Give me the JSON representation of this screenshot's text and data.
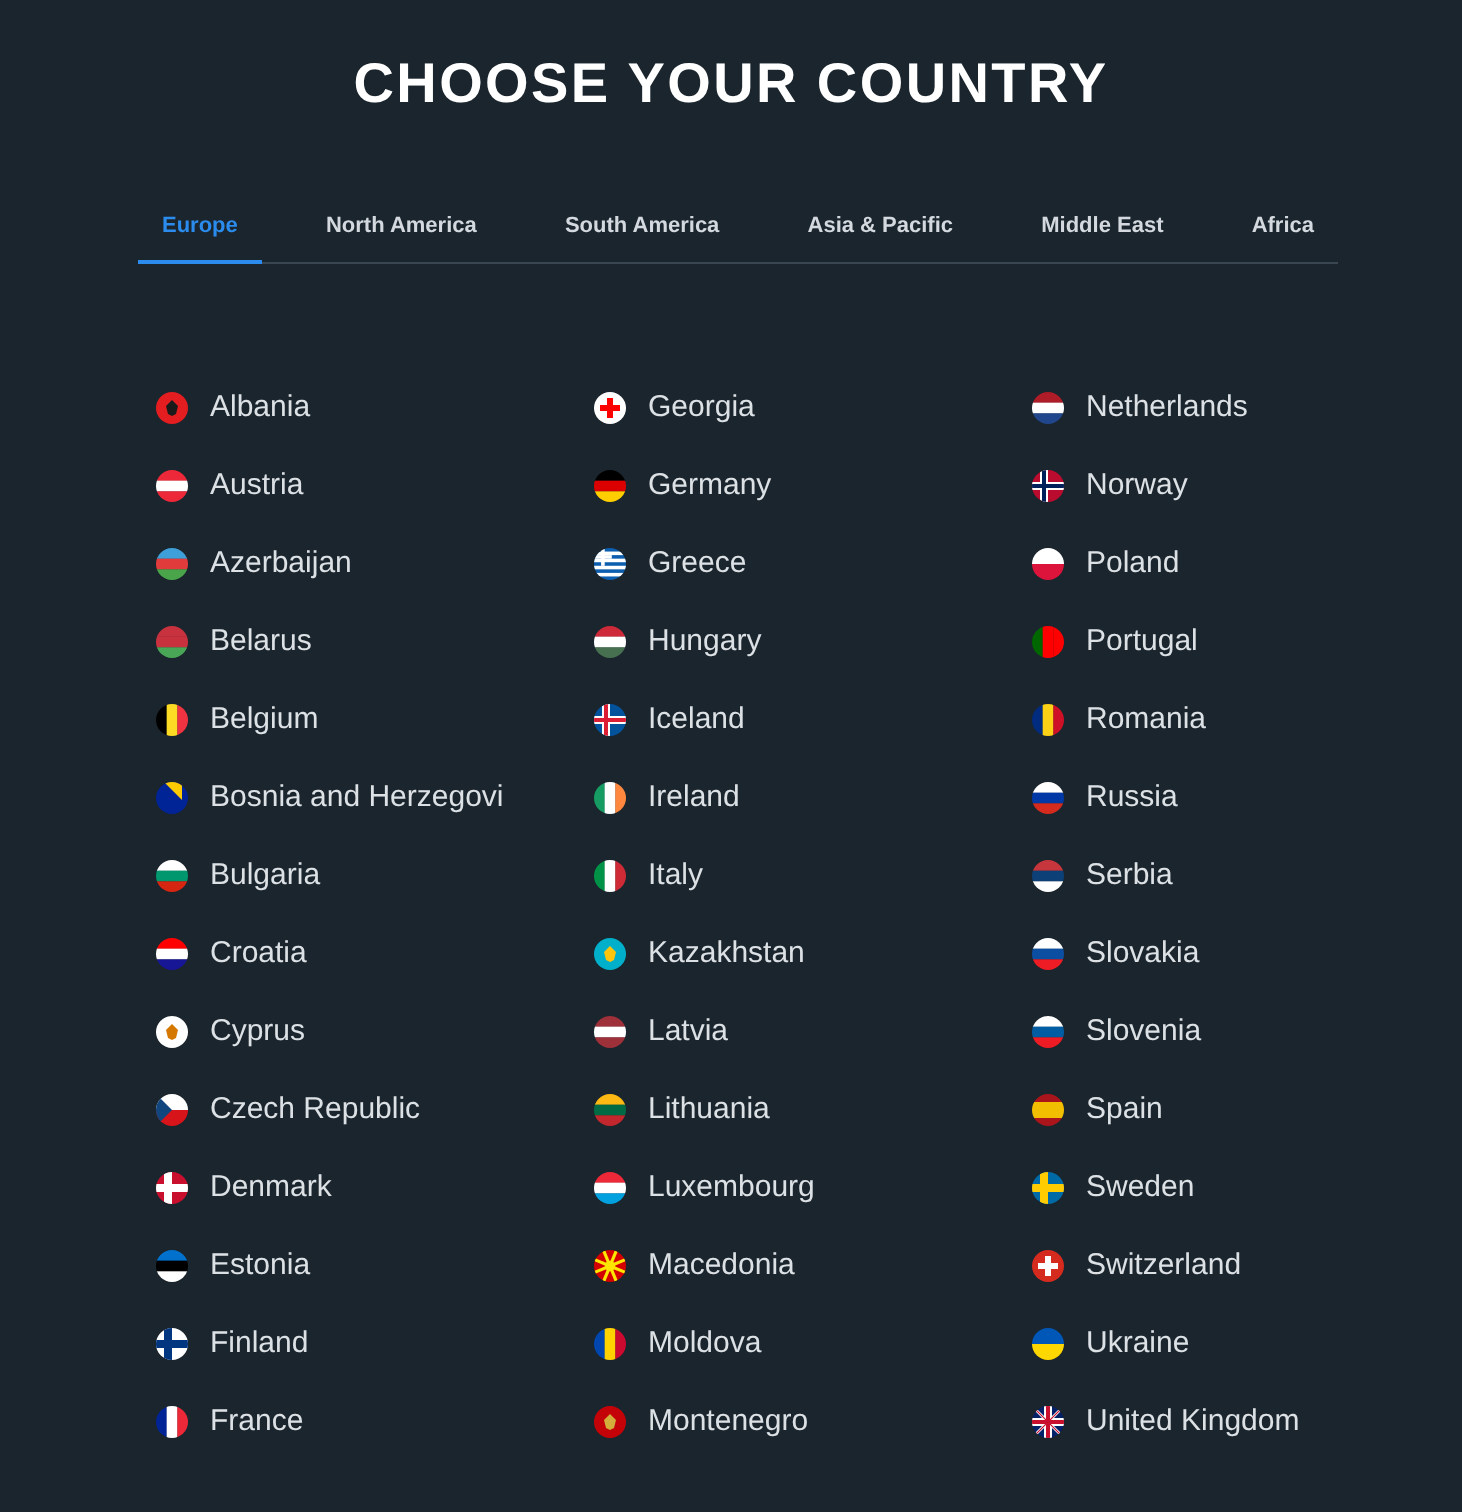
{
  "title": "CHOOSE YOUR COUNTRY",
  "tabs": [
    {
      "label": "Europe",
      "selected": true
    },
    {
      "label": "North America",
      "selected": false
    },
    {
      "label": "South America",
      "selected": false
    },
    {
      "label": "Asia & Pacific",
      "selected": false
    },
    {
      "label": "Middle East",
      "selected": false
    },
    {
      "label": "Africa",
      "selected": false
    }
  ],
  "columns": [
    {
      "countries": [
        {
          "name": "Albania",
          "flag": {
            "kind": "emblem",
            "parts": [
              {
                "color": "#e41e20"
              },
              {
                "color": "#1a1a1a"
              }
            ]
          }
        },
        {
          "name": "Austria",
          "flag": {
            "kind": "horizontal",
            "parts": [
              {
                "color": "#ed2939"
              },
              {
                "color": "#ffffff"
              },
              {
                "color": "#ed2939"
              }
            ]
          }
        },
        {
          "name": "Azerbaijan",
          "flag": {
            "kind": "horizontal",
            "parts": [
              {
                "color": "#3f9fd8"
              },
              {
                "color": "#e23b3b"
              },
              {
                "color": "#4aa54a"
              }
            ]
          }
        },
        {
          "name": "Belarus",
          "flag": {
            "kind": "horizontal",
            "parts": [
              {
                "color": "#c8313e"
              },
              {
                "color": "#c8313e"
              },
              {
                "color": "#4aa657"
              }
            ]
          }
        },
        {
          "name": "Belgium",
          "flag": {
            "kind": "vertical",
            "parts": [
              {
                "color": "#000000"
              },
              {
                "color": "#fdda24"
              },
              {
                "color": "#ef3340"
              }
            ]
          }
        },
        {
          "name": "Bosnia and Herzegovi",
          "flag": {
            "kind": "diagonal",
            "parts": [
              {
                "color": "#002395"
              },
              {
                "color": "#fecb00"
              }
            ]
          }
        },
        {
          "name": "Bulgaria",
          "flag": {
            "kind": "horizontal",
            "parts": [
              {
                "color": "#ffffff"
              },
              {
                "color": "#00966e"
              },
              {
                "color": "#d62612"
              }
            ]
          }
        },
        {
          "name": "Croatia",
          "flag": {
            "kind": "horizontal",
            "parts": [
              {
                "color": "#ff0000"
              },
              {
                "color": "#ffffff"
              },
              {
                "color": "#171796"
              }
            ]
          }
        },
        {
          "name": "Cyprus",
          "flag": {
            "kind": "emblem",
            "parts": [
              {
                "color": "#ffffff"
              },
              {
                "color": "#d57800"
              }
            ]
          }
        },
        {
          "name": "Czech Republic",
          "flag": {
            "kind": "triangle",
            "parts": [
              {
                "color": "#ffffff"
              },
              {
                "color": "#d7141a"
              },
              {
                "color": "#11457e"
              }
            ]
          }
        },
        {
          "name": "Denmark",
          "flag": {
            "kind": "nordic",
            "parts": [
              {
                "color": "#c8102e"
              },
              {
                "color": "#ffffff"
              }
            ]
          }
        },
        {
          "name": "Estonia",
          "flag": {
            "kind": "horizontal",
            "parts": [
              {
                "color": "#0072ce"
              },
              {
                "color": "#000000"
              },
              {
                "color": "#ffffff"
              }
            ]
          }
        },
        {
          "name": "Finland",
          "flag": {
            "kind": "nordic",
            "parts": [
              {
                "color": "#ffffff"
              },
              {
                "color": "#003580"
              }
            ]
          }
        },
        {
          "name": "France",
          "flag": {
            "kind": "vertical",
            "parts": [
              {
                "color": "#002395"
              },
              {
                "color": "#ffffff"
              },
              {
                "color": "#ed2939"
              }
            ]
          }
        }
      ]
    },
    {
      "countries": [
        {
          "name": "Georgia",
          "flag": {
            "kind": "cross",
            "parts": [
              {
                "color": "#ffffff"
              },
              {
                "color": "#ff0000"
              }
            ]
          }
        },
        {
          "name": "Germany",
          "flag": {
            "kind": "horizontal",
            "parts": [
              {
                "color": "#000000"
              },
              {
                "color": "#dd0000"
              },
              {
                "color": "#ffce00"
              }
            ]
          }
        },
        {
          "name": "Greece",
          "flag": {
            "kind": "canton",
            "parts": [
              {
                "color": "#0d5eaf"
              },
              {
                "color": "#ffffff"
              }
            ]
          }
        },
        {
          "name": "Hungary",
          "flag": {
            "kind": "horizontal",
            "parts": [
              {
                "color": "#ce2939"
              },
              {
                "color": "#ffffff"
              },
              {
                "color": "#477050"
              }
            ]
          }
        },
        {
          "name": "Iceland",
          "flag": {
            "kind": "nordic",
            "parts": [
              {
                "color": "#02529c"
              },
              {
                "color": "#ffffff"
              },
              {
                "color": "#dc1e35"
              }
            ]
          }
        },
        {
          "name": "Ireland",
          "flag": {
            "kind": "vertical",
            "parts": [
              {
                "color": "#169b62"
              },
              {
                "color": "#ffffff"
              },
              {
                "color": "#ff883e"
              }
            ]
          }
        },
        {
          "name": "Italy",
          "flag": {
            "kind": "vertical",
            "parts": [
              {
                "color": "#009246"
              },
              {
                "color": "#ffffff"
              },
              {
                "color": "#ce2b37"
              }
            ]
          }
        },
        {
          "name": "Kazakhstan",
          "flag": {
            "kind": "emblem",
            "parts": [
              {
                "color": "#00afca"
              },
              {
                "color": "#fec50c"
              }
            ]
          }
        },
        {
          "name": "Latvia",
          "flag": {
            "kind": "horizontal",
            "parts": [
              {
                "color": "#9e3039"
              },
              {
                "color": "#ffffff"
              },
              {
                "color": "#9e3039"
              }
            ]
          }
        },
        {
          "name": "Lithuania",
          "flag": {
            "kind": "horizontal",
            "parts": [
              {
                "color": "#fdb913"
              },
              {
                "color": "#006a44"
              },
              {
                "color": "#c1272d"
              }
            ]
          }
        },
        {
          "name": "Luxembourg",
          "flag": {
            "kind": "horizontal",
            "parts": [
              {
                "color": "#ed2939"
              },
              {
                "color": "#ffffff"
              },
              {
                "color": "#00a1de"
              }
            ]
          }
        },
        {
          "name": "Macedonia",
          "flag": {
            "kind": "sunburst",
            "parts": [
              {
                "color": "#d20000"
              },
              {
                "color": "#ffe600"
              }
            ]
          }
        },
        {
          "name": "Moldova",
          "flag": {
            "kind": "vertical",
            "parts": [
              {
                "color": "#0046ae"
              },
              {
                "color": "#ffd200"
              },
              {
                "color": "#cc092f"
              }
            ]
          }
        },
        {
          "name": "Montenegro",
          "flag": {
            "kind": "emblem",
            "parts": [
              {
                "color": "#c40308"
              },
              {
                "color": "#d3ae3b"
              }
            ]
          }
        }
      ]
    },
    {
      "countries": [
        {
          "name": "Netherlands",
          "flag": {
            "kind": "horizontal",
            "parts": [
              {
                "color": "#ae1c28"
              },
              {
                "color": "#ffffff"
              },
              {
                "color": "#21468b"
              }
            ]
          }
        },
        {
          "name": "Norway",
          "flag": {
            "kind": "nordic",
            "parts": [
              {
                "color": "#ba0c2f"
              },
              {
                "color": "#ffffff"
              },
              {
                "color": "#00205b"
              }
            ]
          }
        },
        {
          "name": "Poland",
          "flag": {
            "kind": "horizontal",
            "parts": [
              {
                "color": "#ffffff"
              },
              {
                "color": "#dc143c"
              }
            ]
          }
        },
        {
          "name": "Portugal",
          "flag": {
            "kind": "vertical",
            "parts": [
              {
                "color": "#006600"
              },
              {
                "color": "#ff0000"
              },
              {
                "color": "#ff0000"
              }
            ]
          }
        },
        {
          "name": "Romania",
          "flag": {
            "kind": "vertical",
            "parts": [
              {
                "color": "#002b7f"
              },
              {
                "color": "#fcd116"
              },
              {
                "color": "#ce1126"
              }
            ]
          }
        },
        {
          "name": "Russia",
          "flag": {
            "kind": "horizontal",
            "parts": [
              {
                "color": "#ffffff"
              },
              {
                "color": "#0039a6"
              },
              {
                "color": "#d52b1e"
              }
            ]
          }
        },
        {
          "name": "Serbia",
          "flag": {
            "kind": "horizontal",
            "parts": [
              {
                "color": "#c6363c"
              },
              {
                "color": "#0c4076"
              },
              {
                "color": "#ffffff"
              }
            ]
          }
        },
        {
          "name": "Slovakia",
          "flag": {
            "kind": "horizontal",
            "parts": [
              {
                "color": "#ffffff"
              },
              {
                "color": "#0b4ea2"
              },
              {
                "color": "#ee1c25"
              }
            ]
          }
        },
        {
          "name": "Slovenia",
          "flag": {
            "kind": "horizontal",
            "parts": [
              {
                "color": "#ffffff"
              },
              {
                "color": "#005da4"
              },
              {
                "color": "#ed1c24"
              }
            ]
          }
        },
        {
          "name": "Spain",
          "flag": {
            "kind": "horizontal",
            "parts": [
              {
                "color": "#aa151b"
              },
              {
                "color": "#f1bf00"
              },
              {
                "color": "#f1bf00"
              },
              {
                "color": "#aa151b"
              }
            ]
          }
        },
        {
          "name": "Sweden",
          "flag": {
            "kind": "nordic",
            "parts": [
              {
                "color": "#006aa7"
              },
              {
                "color": "#fecc00"
              }
            ]
          }
        },
        {
          "name": "Switzerland",
          "flag": {
            "kind": "cross",
            "parts": [
              {
                "color": "#d52b1e"
              },
              {
                "color": "#ffffff"
              }
            ]
          }
        },
        {
          "name": "Ukraine",
          "flag": {
            "kind": "horizontal",
            "parts": [
              {
                "color": "#0057b7"
              },
              {
                "color": "#ffd700"
              }
            ]
          }
        },
        {
          "name": "United Kingdom",
          "flag": {
            "kind": "union",
            "parts": [
              {
                "color": "#012169"
              },
              {
                "color": "#ffffff"
              },
              {
                "color": "#c8102e"
              }
            ]
          }
        }
      ]
    }
  ]
}
